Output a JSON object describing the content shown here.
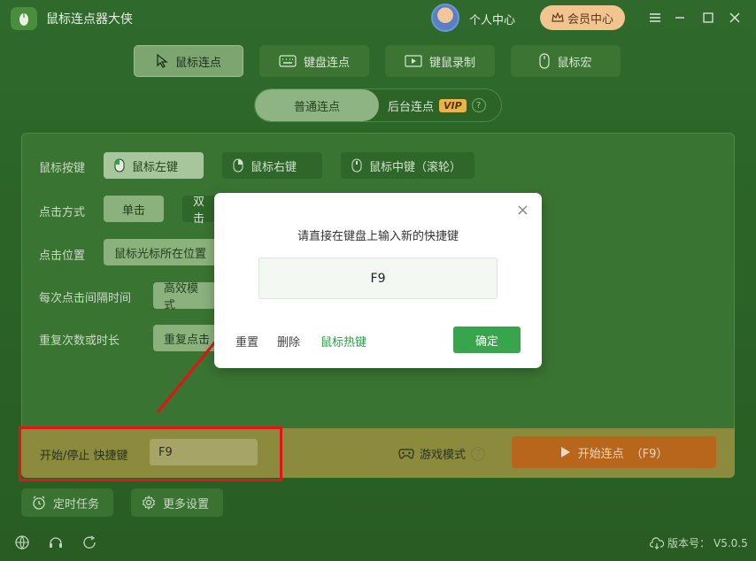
{
  "app": {
    "title": "鼠标连点器大侠",
    "personal_center": "个人中心",
    "member_center": "会员中心"
  },
  "main_tabs": [
    {
      "label": "鼠标连点",
      "icon": "cursor-icon",
      "active": true
    },
    {
      "label": "键盘连点",
      "icon": "keyboard-icon",
      "active": false
    },
    {
      "label": "键鼠录制",
      "icon": "record-icon",
      "active": false
    },
    {
      "label": "鼠标宏",
      "icon": "mouse-icon",
      "active": false
    }
  ],
  "sub_tabs": {
    "normal": "普通连点",
    "background": "后台连点",
    "vip_badge": "VIP",
    "help": "?"
  },
  "settings": {
    "mouse_button": {
      "label": "鼠标按键",
      "options": [
        "鼠标左键",
        "鼠标右键",
        "鼠标中键（滚轮）"
      ],
      "selected": "鼠标左键"
    },
    "click_method": {
      "label": "点击方式",
      "options": [
        "单击",
        "双击"
      ],
      "selected": "单击"
    },
    "click_position": {
      "label": "点击位置",
      "value": "鼠标光标所在位置"
    },
    "interval": {
      "label": "每次点击间隔时间",
      "value": "高效模式"
    },
    "repeat": {
      "label": "重复次数或时长",
      "value": "重复点击"
    }
  },
  "hotkey": {
    "label": "开始/停止 快捷键",
    "value": "F9"
  },
  "game_mode": {
    "label": "游戏模式",
    "help": "?"
  },
  "start_button": {
    "label": "开始连点",
    "hotkey": "（F9）"
  },
  "footer": {
    "timer": "定时任务",
    "more": "更多设置",
    "version_label": "版本号：",
    "version": "V5.0.5"
  },
  "dialog": {
    "prompt": "请直接在键盘上输入新的快捷键",
    "key": "F9",
    "reset": "重置",
    "delete": "删除",
    "mouse_hotkey": "鼠标热键",
    "confirm": "确定",
    "close": "×"
  },
  "colors": {
    "accent_green": "#38a44b",
    "annotation_red": "#e01515",
    "start_orange": "#b9661d"
  }
}
